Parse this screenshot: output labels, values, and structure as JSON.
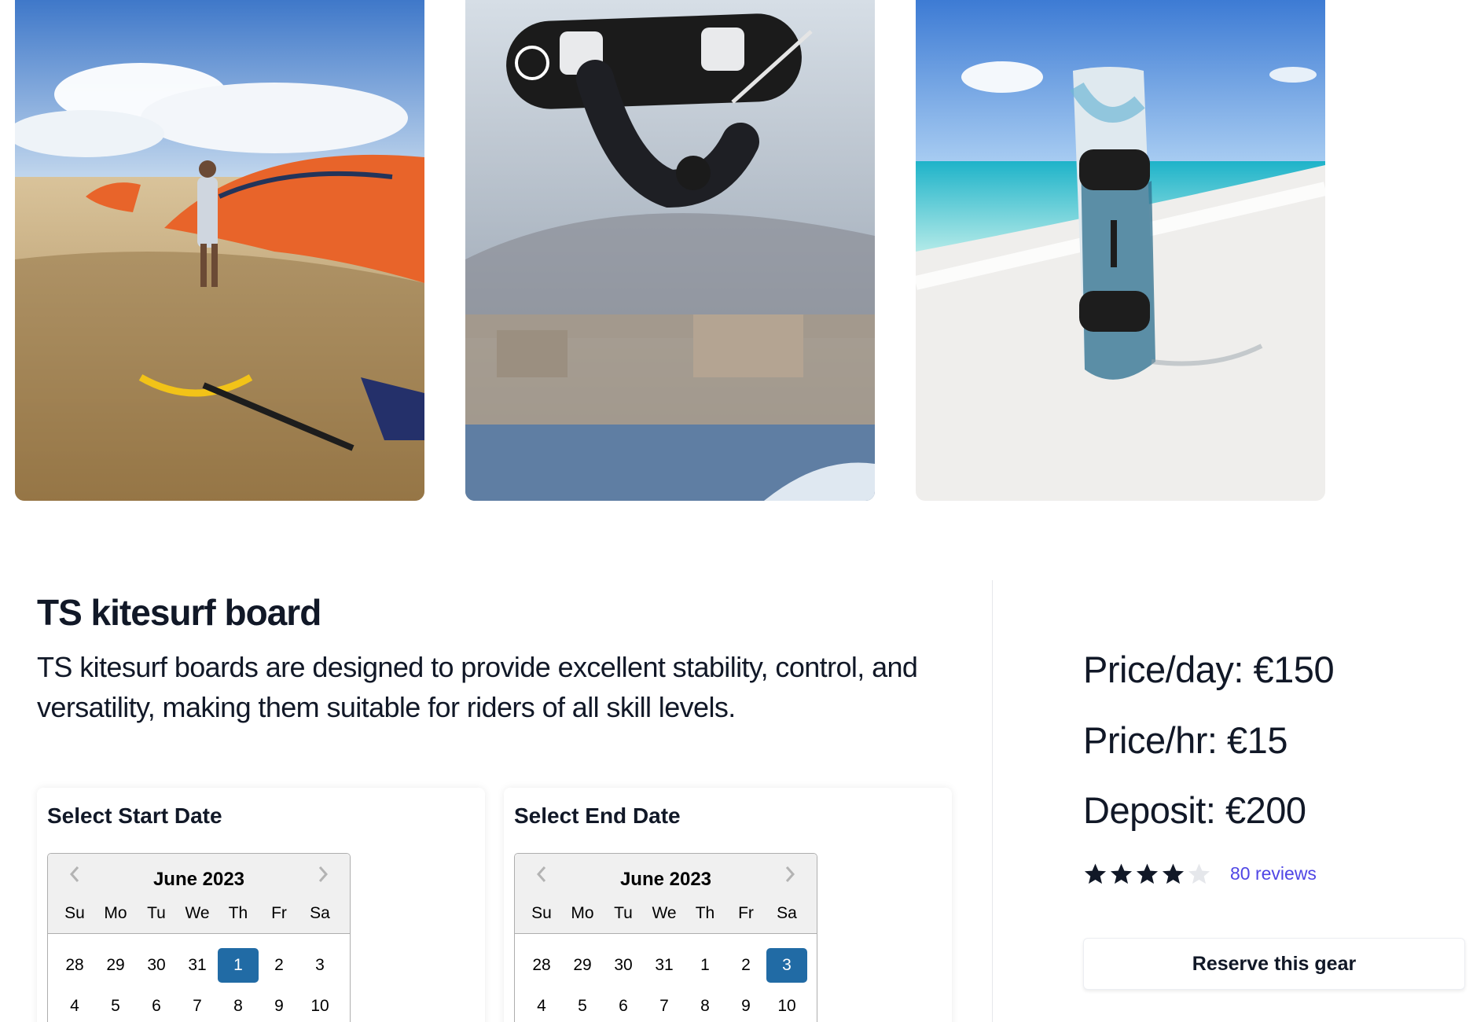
{
  "gallery": [
    {
      "icon": "photo-kitesurfer-on-beach"
    },
    {
      "icon": "photo-kitesurfer-jumping"
    },
    {
      "icon": "photo-board-on-beach"
    }
  ],
  "product": {
    "title": "TS kitesurf board",
    "description": "TS kitesurf boards are designed to provide excellent stability, control, and versatility, making them suitable for riders of all skill levels."
  },
  "start_date": {
    "heading": "Select Start Date",
    "month": "June 2023",
    "weekdays": [
      "Su",
      "Mo",
      "Tu",
      "We",
      "Th",
      "Fr",
      "Sa"
    ],
    "weeks": [
      [
        "28",
        "29",
        "30",
        "31",
        "1",
        "2",
        "3"
      ],
      [
        "4",
        "5",
        "6",
        "7",
        "8",
        "9",
        "10"
      ]
    ],
    "selected": "1"
  },
  "end_date": {
    "heading": "Select End Date",
    "month": "June 2023",
    "weekdays": [
      "Su",
      "Mo",
      "Tu",
      "We",
      "Th",
      "Fr",
      "Sa"
    ],
    "weeks": [
      [
        "28",
        "29",
        "30",
        "31",
        "1",
        "2",
        "3"
      ],
      [
        "4",
        "5",
        "6",
        "7",
        "8",
        "9",
        "10"
      ]
    ],
    "selected": "3"
  },
  "pricing": {
    "per_day": "Price/day: €150",
    "per_hour": "Price/hr: €15",
    "deposit": "Deposit: €200"
  },
  "rating": {
    "stars": 4,
    "max_stars": 5,
    "reviews_label": "80 reviews",
    "star_color": "#111827",
    "empty_star_color": "#e5e7eb",
    "link_color": "#4f46e5"
  },
  "reserve_label": "Reserve this gear",
  "colors": {
    "selected_day": "#216ba5",
    "calendar_header": "#f0f0f0"
  }
}
